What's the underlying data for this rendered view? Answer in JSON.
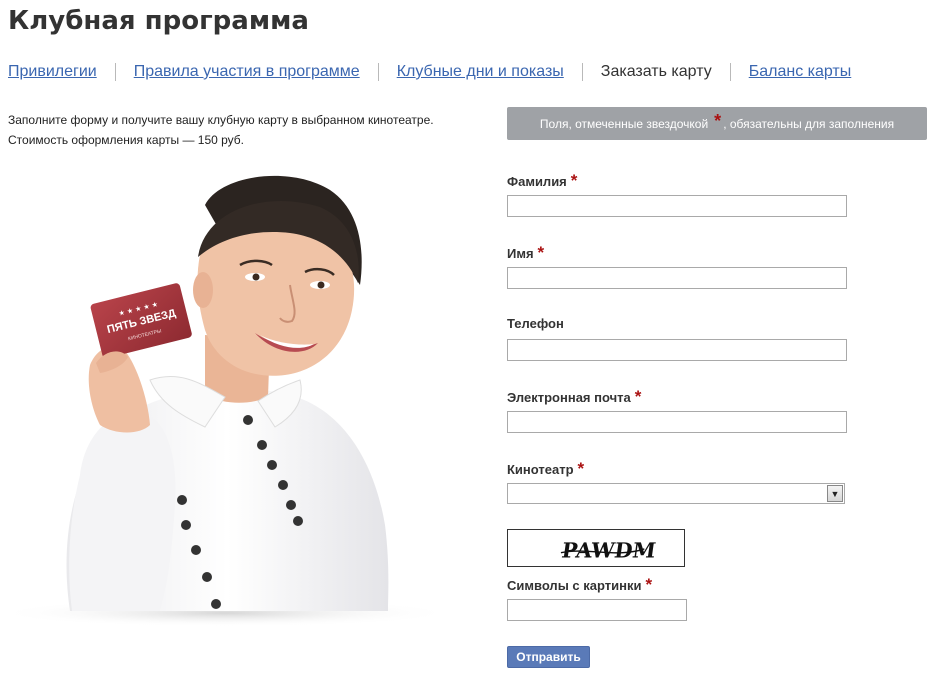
{
  "page": {
    "title": "Клубная программа"
  },
  "nav": {
    "items": [
      {
        "label": "Привилегии",
        "current": false
      },
      {
        "label": "Правила участия в программе",
        "current": false
      },
      {
        "label": "Клубные дни и показы",
        "current": false
      },
      {
        "label": "Заказать карту",
        "current": true
      },
      {
        "label": "Баланс карты",
        "current": false
      }
    ]
  },
  "intro": {
    "line1": "Заполните форму и получите вашу клубную карту в выбранном кинотеатре.",
    "line2": "Стоимость оформления карты — 150 руб."
  },
  "promo": {
    "card_text": "ПЯТЬ ЗВЕЗД",
    "card_subtext": "КИНОТЕАТРЫ"
  },
  "notice": {
    "before": "Поля, отмеченные звездочкой",
    "asterisk": "*",
    "after": ", обязательны для заполнения"
  },
  "form": {
    "required_mark": "*",
    "fields": {
      "surname": {
        "label": "Фамилия",
        "value": "",
        "required": true
      },
      "name": {
        "label": "Имя",
        "value": "",
        "required": true
      },
      "phone": {
        "label": "Телефон",
        "value": "",
        "required": false
      },
      "email": {
        "label": "Электронная почта",
        "value": "",
        "required": true
      },
      "cinema": {
        "label": "Кинотеатр",
        "value": "",
        "required": true
      },
      "captcha": {
        "label": "Символы с картинки",
        "value": "",
        "required": true
      }
    },
    "captcha_text": "PAWDM",
    "submit_label": "Отправить"
  },
  "colors": {
    "link": "#3a66b0",
    "required": "#aa1111",
    "notice_bg": "#9fa2a6",
    "button_bg": "#5a7ab8",
    "card": "#a8353c"
  }
}
